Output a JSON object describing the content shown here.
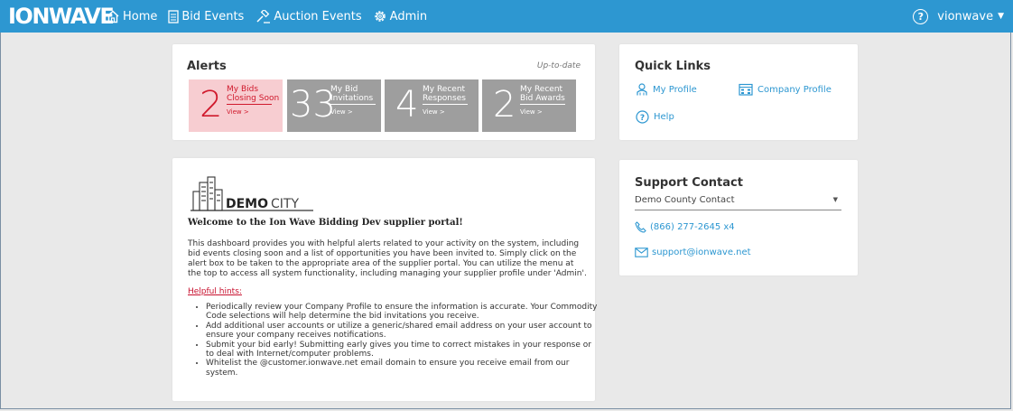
{
  "app": {
    "logo": "IONWAVE",
    "nav": [
      {
        "label": "Home",
        "icon": "home-icon"
      },
      {
        "label": "Bid Events",
        "icon": "document-icon"
      },
      {
        "label": "Auction Events",
        "icon": "gavel-icon"
      },
      {
        "label": "Admin",
        "icon": "gear-icon"
      }
    ],
    "user": {
      "help_icon": "help-icon",
      "name": "vionwave",
      "caret_icon": "caret-down-icon"
    },
    "colors": {
      "topbar": "#2d97d1",
      "alert_bg": "#f7cdd1",
      "alert_text": "#d0192c",
      "tile_gray": "#9e9e9e",
      "link": "#2d97d1"
    }
  },
  "alerts": {
    "title": "Alerts",
    "status": "Up-to-date",
    "tiles": [
      {
        "count": "2",
        "line1": "My Bids",
        "line2": "Closing Soon",
        "view": "View >"
      },
      {
        "count": "33",
        "line1": "My Bid",
        "line2": "Invitations",
        "view": "View >"
      },
      {
        "count": "4",
        "line1": "My Recent",
        "line2": "Responses",
        "view": "View >"
      },
      {
        "count": "2",
        "line1": "My Recent",
        "line2": "Bid Awards",
        "view": "View >"
      }
    ]
  },
  "quick_links": {
    "title": "Quick Links",
    "items": [
      {
        "label": "My Profile",
        "icon": "user-icon"
      },
      {
        "label": "Company Profile",
        "icon": "company-icon"
      },
      {
        "label": "Help",
        "icon": "help-icon"
      }
    ]
  },
  "support": {
    "title": "Support Contact",
    "selected_contact": "Demo County Contact",
    "phone": "(866) 277-2645 x4",
    "email": "support@ionwave.net"
  },
  "welcome": {
    "logo_bold": "DEMO",
    "logo_light": "CITY",
    "heading": "Welcome to the Ion Wave Bidding Dev supplier portal!",
    "body": "This dashboard provides you with helpful alerts related to your activity on the system, including bid events closing soon and a list of opportunities you have been invited to. Simply click on the alert box to be taken to the appropriate area of the supplier portal. You can utilize the menu at the top to access all system functionality, including managing your supplier profile under 'Admin'.",
    "hints_label": "Helpful hints:",
    "hints": [
      "Periodically review your Company Profile to ensure the information is accurate. Your Commodity Code selections will help determine the bid invitations you receive.",
      "Add additional user accounts or utilize a generic/shared email address on your user account to ensure your company receives notifications.",
      "Submit your bid early! Submitting early gives you time to correct mistakes in your response or to deal with Internet/computer problems.",
      "Whitelist the @customer.ionwave.net email domain to ensure you receive email from our system."
    ]
  }
}
